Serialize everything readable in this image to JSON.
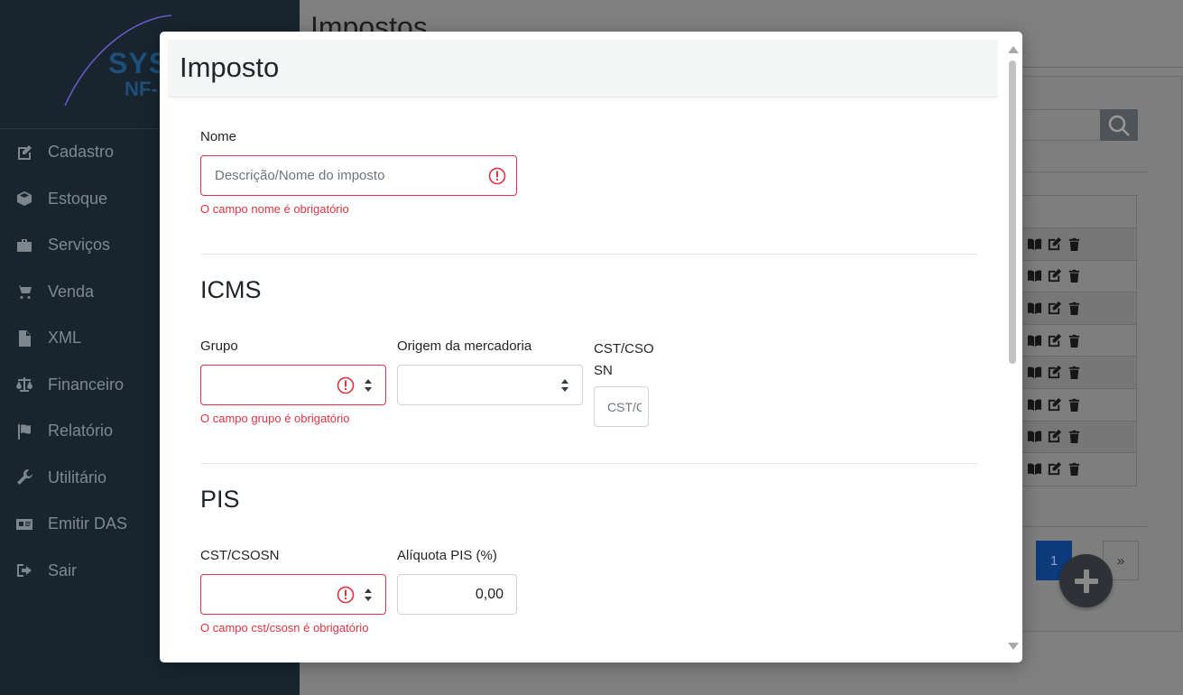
{
  "sidebar": {
    "logo_line1": "SYS",
    "logo_line2": "NF-",
    "items": [
      {
        "label": "Cadastro",
        "icon": "edit-icon"
      },
      {
        "label": "Estoque",
        "icon": "box-icon"
      },
      {
        "label": "Serviços",
        "icon": "briefcase-icon"
      },
      {
        "label": "Venda",
        "icon": "cart-icon"
      },
      {
        "label": "XML",
        "icon": "file-icon"
      },
      {
        "label": "Financeiro",
        "icon": "balance-scale-icon"
      },
      {
        "label": "Relatório",
        "icon": "flag-icon"
      },
      {
        "label": "Utilitário",
        "icon": "wrench-icon"
      },
      {
        "label": "Emitir DAS",
        "icon": "id-card-icon"
      },
      {
        "label": "Sair",
        "icon": "sign-out-icon"
      }
    ]
  },
  "page": {
    "title": "Impostos",
    "pagination": {
      "current": "1",
      "next": "»"
    }
  },
  "modal": {
    "title": "Imposto",
    "nome": {
      "label": "Nome",
      "placeholder": "Descrição/Nome do imposto",
      "error": "O campo nome é obrigatório"
    },
    "icms": {
      "heading": "ICMS",
      "grupo_label": "Grupo",
      "grupo_error": "O campo grupo é obrigatório",
      "origem_label": "Origem da mercadoria",
      "cst_label_line1": "CST/CSO",
      "cst_label_line2": "SN",
      "cst_placeholder": "CST/CSOSN"
    },
    "pis": {
      "heading": "PIS",
      "cst_label": "CST/CSOSN",
      "cst_error": "O campo cst/csosn é obrigatório",
      "aliquota_label": "Alíquota PIS (%)",
      "aliquota_value": "0,00"
    }
  },
  "colors": {
    "sidebar_bg": "#18252f",
    "error": "#dc3545",
    "accent": "#0c3a7a"
  }
}
